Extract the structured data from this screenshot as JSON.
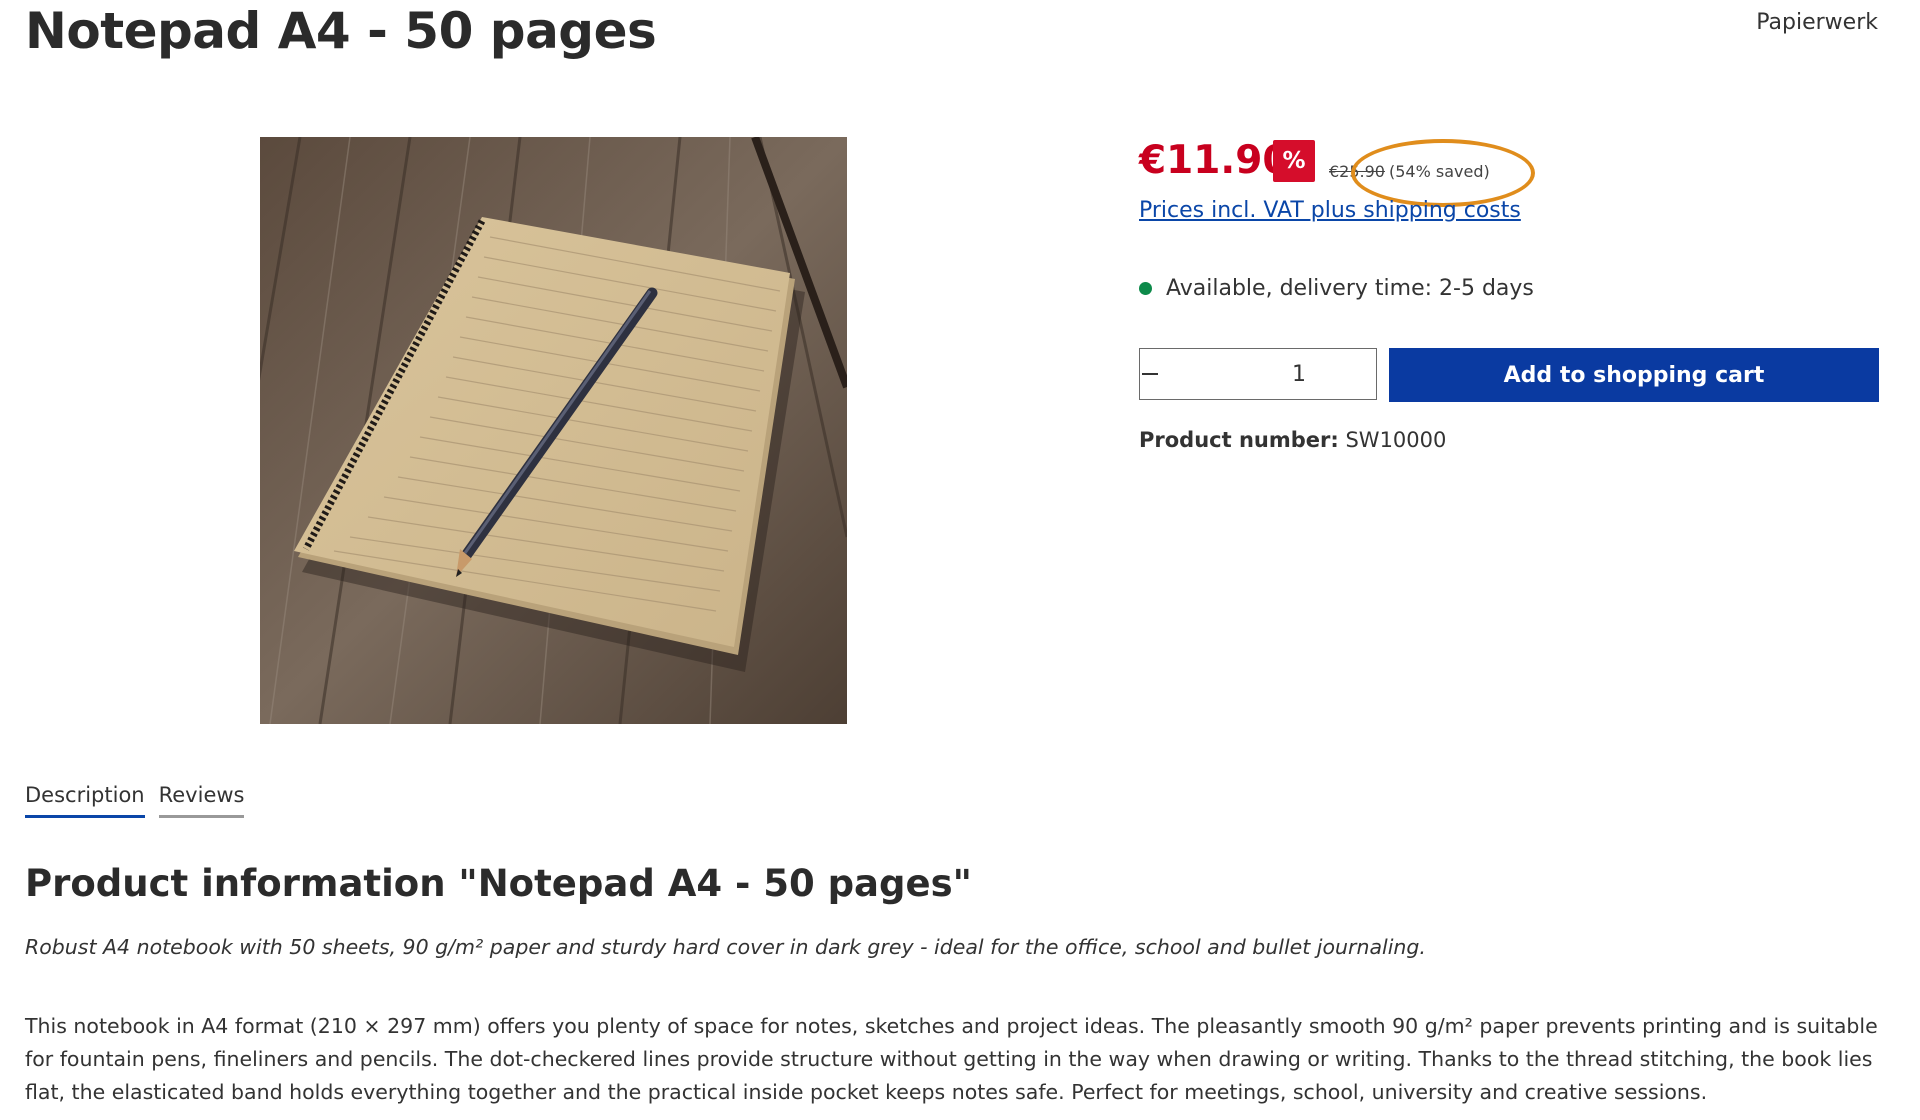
{
  "product": {
    "title": "Notepad A4 - 50 pages",
    "manufacturer": "Papierwerk",
    "image_alt": "Notepad with pencil on wooden table"
  },
  "pricing": {
    "price": "€11.90",
    "sale_badge": "%",
    "old_price": "€25.90",
    "saved_text": "(54% saved)",
    "vat_link": "Prices incl. VAT plus shipping costs",
    "accent_color": "#c8001e",
    "highlight_color": "#e08d1c"
  },
  "availability": {
    "text": "Available, delivery time: 2-5 days",
    "status_color": "#0d8a4a"
  },
  "purchase": {
    "decrement_icon": "minus-icon",
    "increment_icon": "plus-icon",
    "quantity": "1",
    "cart_label": "Add to shopping cart",
    "button_color": "#0a3aa1"
  },
  "product_number": {
    "label": "Product number:",
    "value": "SW10000"
  },
  "tabs": [
    {
      "label": "Description"
    },
    {
      "label": "Reviews"
    }
  ],
  "info": {
    "heading": "Product information \"Notepad A4 - 50 pages\"",
    "lead": "Robust A4 notebook with 50 sheets, 90 g/m² paper and sturdy hard cover in dark grey - ideal for the office, school and bullet journaling.",
    "body": "This notebook in A4 format (210 × 297 mm) offers you plenty of space for notes, sketches and project ideas. The pleasantly smooth 90 g/m² paper prevents printing and is suitable for fountain pens, fineliners and pencils. The dot-checkered lines provide structure without getting in the way when drawing or writing. Thanks to the thread stitching, the book lies flat, the elasticated band holds everything together and the practical inside pocket keeps notes safe. Perfect for meetings, school, university and creative sessions."
  }
}
